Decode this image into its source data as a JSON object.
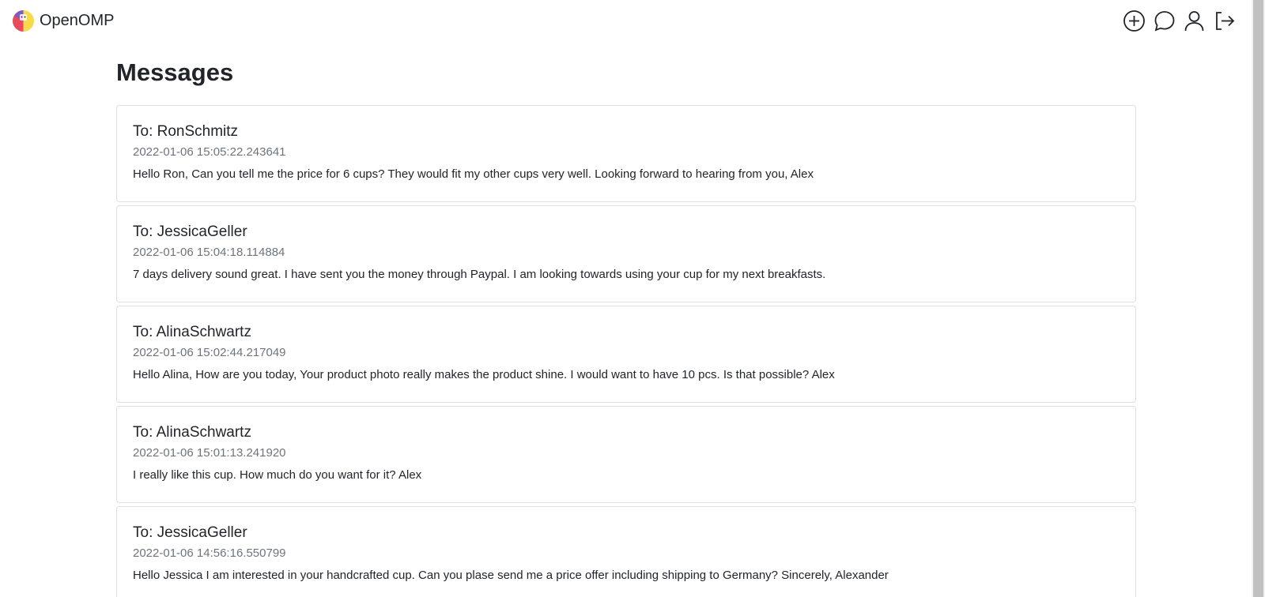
{
  "brand": {
    "name": "OpenOMP"
  },
  "nav": {
    "icons": [
      "add-icon",
      "chat-icon",
      "person-icon",
      "logout-icon"
    ]
  },
  "page": {
    "title": "Messages"
  },
  "messages": [
    {
      "to": "To: RonSchmitz",
      "date": "2022-01-06 15:05:22.243641",
      "body": "Hello Ron, Can you tell me the price for 6 cups? They would fit my other cups very well. Looking forward to hearing from you, Alex"
    },
    {
      "to": "To: JessicaGeller",
      "date": "2022-01-06 15:04:18.114884",
      "body": "7 days delivery sound great. I have sent you the money through Paypal. I am looking towards using your cup for my next breakfasts."
    },
    {
      "to": "To: AlinaSchwartz",
      "date": "2022-01-06 15:02:44.217049",
      "body": "Hello Alina, How are you today, Your product photo really makes the product shine. I would want to have 10 pcs. Is that possible? Alex"
    },
    {
      "to": "To: AlinaSchwartz",
      "date": "2022-01-06 15:01:13.241920",
      "body": "I really like this cup. How much do you want for it? Alex"
    },
    {
      "to": "To: JessicaGeller",
      "date": "2022-01-06 14:56:16.550799",
      "body": "Hello Jessica I am interested in your handcrafted cup. Can you plase send me a price offer including shipping to Germany? Sincerely, Alexander"
    }
  ]
}
